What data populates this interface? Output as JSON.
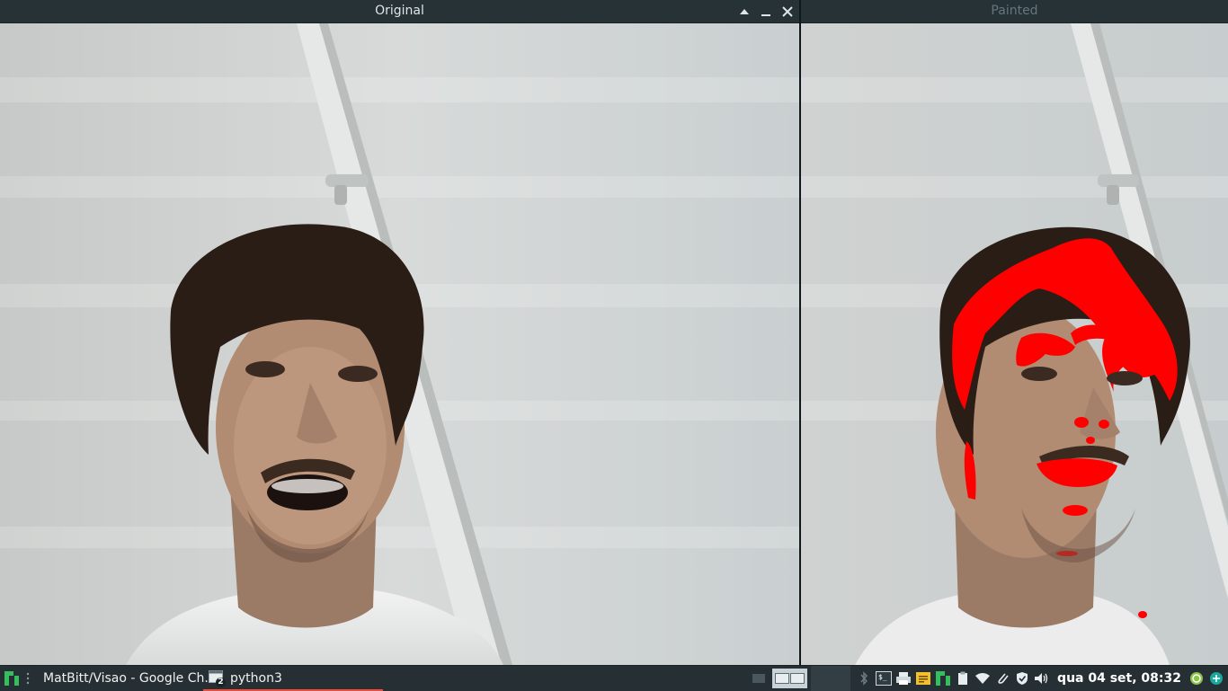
{
  "windows": {
    "original": {
      "title": "Original",
      "controls": [
        "maximize-arrow",
        "minimize",
        "close"
      ]
    },
    "painted": {
      "title": "Painted"
    }
  },
  "taskbar": {
    "menu_icon": "manjaro-logo-icon",
    "tasks": [
      {
        "icon": "chrome-icon",
        "label": "MatBitt/Visao - Google Ch...",
        "active": false
      },
      {
        "icon": "terminal-window-icon",
        "label": "python3",
        "badge": "2",
        "active": true
      }
    ],
    "tray_icons": [
      "bluetooth-icon",
      "terminal-icon",
      "printer-icon",
      "notes-icon",
      "manjaro-settings-icon",
      "clipboard-icon",
      "wifi-icon",
      "paperclip-icon",
      "shield-icon",
      "volume-icon"
    ],
    "clock": "qua 04 set, 08:32",
    "update_icon": "update-icon",
    "network_icon": "network-icon"
  },
  "colors": {
    "accent": "#e84c3d",
    "overlay": "#ff0000",
    "panel": "#263034"
  }
}
